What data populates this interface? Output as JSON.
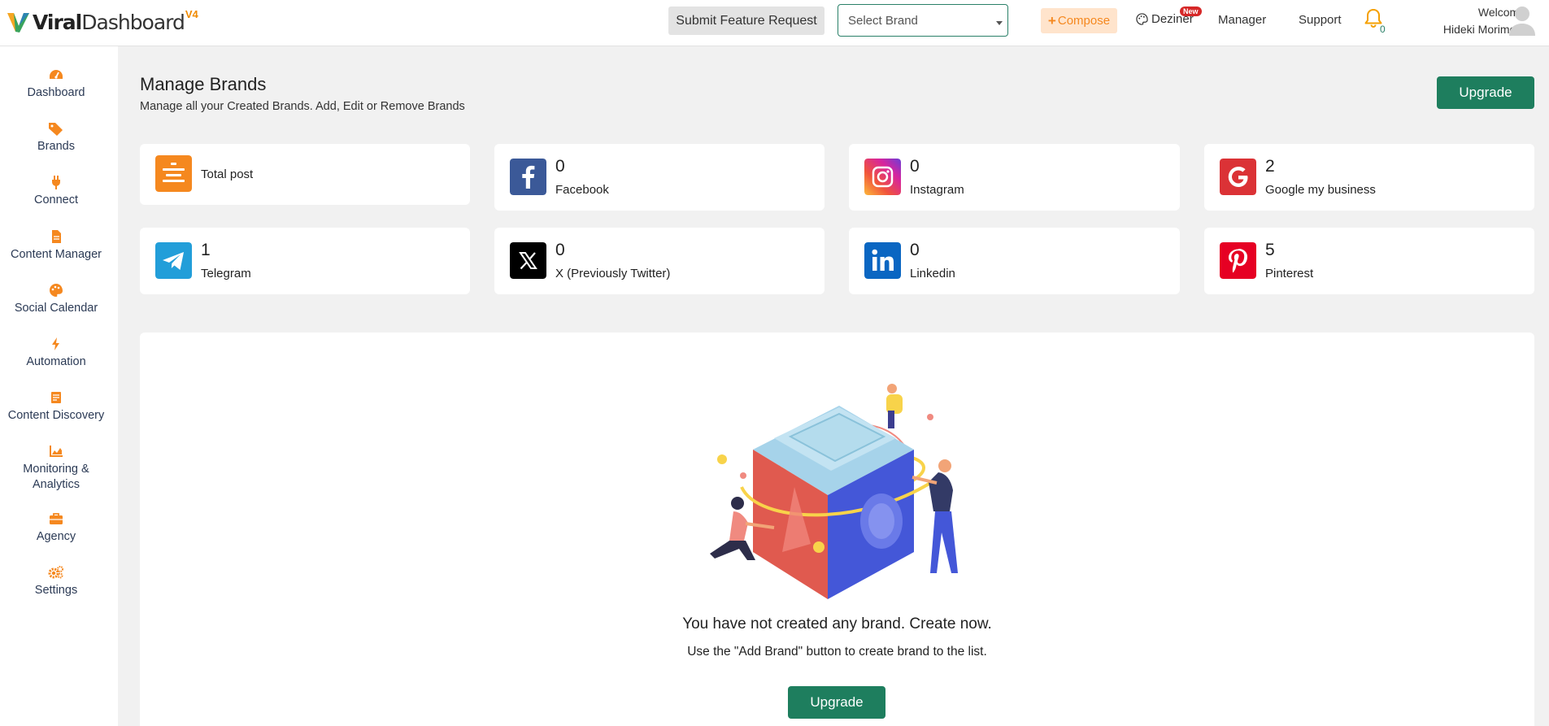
{
  "header": {
    "logo_word1": "Viral",
    "logo_word2": "Dashboard",
    "logo_version": "V4",
    "feature_request_label": "Submit Feature Request",
    "brand_select_value": "Select Brand",
    "compose_label": "Compose",
    "dezinr_label": "Deziner",
    "dezinr_badge": "New",
    "manager_label": "Manager",
    "support_label": "Support",
    "notification_count": "0",
    "welcome_label": "Welcome",
    "user_name": "Hideki Morimoto"
  },
  "sidebar": {
    "items": [
      {
        "label": "Dashboard",
        "icon": "gauge-icon"
      },
      {
        "label": "Brands",
        "icon": "tags-icon"
      },
      {
        "label": "Connect",
        "icon": "plug-icon"
      },
      {
        "label": "Content Manager",
        "icon": "file-icon"
      },
      {
        "label": "Social Calendar",
        "icon": "palette-icon"
      },
      {
        "label": "Automation",
        "icon": "bolt-icon"
      },
      {
        "label": "Content Discovery",
        "icon": "list-icon"
      },
      {
        "label": "Monitoring & Analytics",
        "icon": "chart-icon"
      },
      {
        "label": "Agency",
        "icon": "briefcase-icon"
      },
      {
        "label": "Settings",
        "icon": "cogs-icon"
      }
    ]
  },
  "main": {
    "title": "Manage Brands",
    "subtitle": "Manage all your Created Brands. Add, Edit or Remove Brands",
    "upgrade_label": "Upgrade",
    "stats": [
      {
        "count": "",
        "label": "Total post",
        "icon": "total-post-icon",
        "color": "#f5881f"
      },
      {
        "count": "0",
        "label": "Facebook",
        "icon": "facebook-icon",
        "color": "#3b5998"
      },
      {
        "count": "0",
        "label": "Instagram",
        "icon": "instagram-icon",
        "color": "#d6249f"
      },
      {
        "count": "2",
        "label": "Google my business",
        "icon": "google-icon",
        "color": "#db3236"
      },
      {
        "count": "1",
        "label": "Telegram",
        "icon": "telegram-icon",
        "color": "#229ed9"
      },
      {
        "count": "0",
        "label": "X (Previously Twitter)",
        "icon": "x-icon",
        "color": "#000000"
      },
      {
        "count": "0",
        "label": "Linkedin",
        "icon": "linkedin-icon",
        "color": "#0a66c2"
      },
      {
        "count": "5",
        "label": "Pinterest",
        "icon": "pinterest-icon",
        "color": "#e60023"
      }
    ],
    "empty_state": {
      "title": "You have not created any brand. Create now.",
      "subtitle": "Use the \"Add Brand\" button to create brand to the list.",
      "button_label": "Upgrade"
    }
  },
  "colors": {
    "accent": "#1e7e5e",
    "brand_orange": "#f5881f"
  }
}
